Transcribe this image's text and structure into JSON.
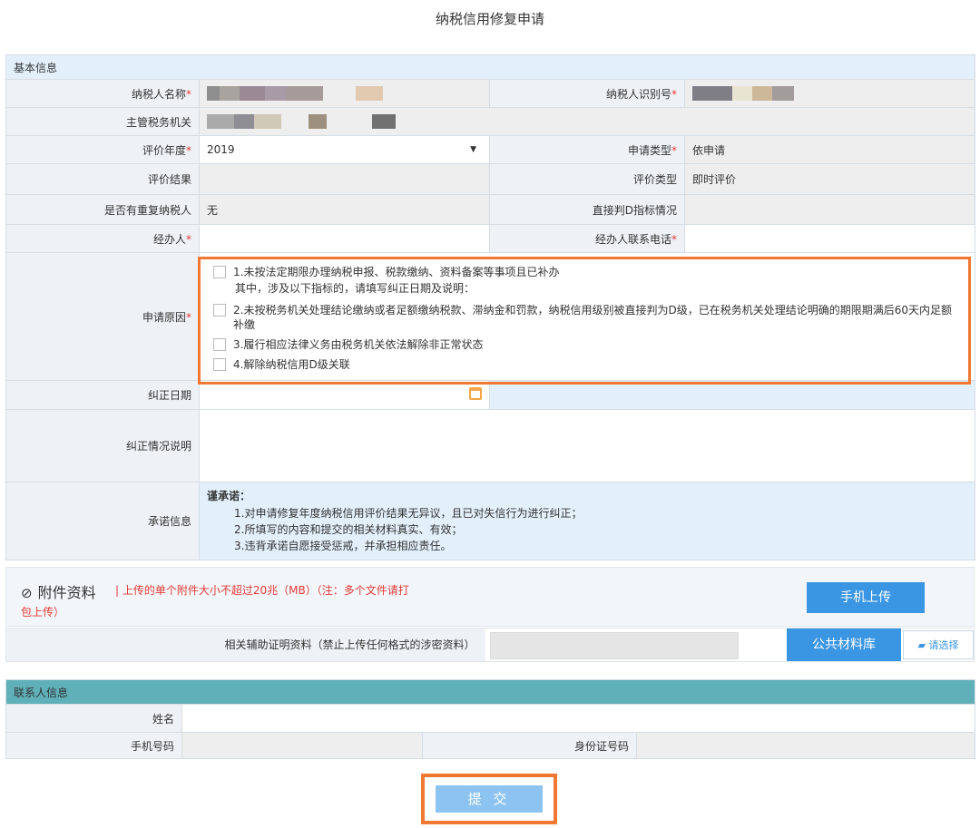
{
  "page": {
    "title": "纳税信用修复申请"
  },
  "basic": {
    "section_title": "基本信息",
    "taxpayer_name_label": "纳税人名称",
    "taxpayer_id_label": "纳税人识别号",
    "authority_label": "主管税务机关",
    "year_label": "评价年度",
    "year_value": "2019",
    "apply_type_label": "申请类型",
    "apply_type_value": "依申请",
    "result_label": "评价结果",
    "result_value": "",
    "eval_type_label": "评价类型",
    "eval_type_value": "即时评价",
    "repeat_label": "是否有重复纳税人",
    "repeat_value": "无",
    "direct_d_label": "直接判D指标情况",
    "direct_d_value": "",
    "agent_label": "经办人",
    "agent_phone_label": "经办人联系电话",
    "required_mark": "*",
    "reason_label": "申请原因",
    "reasons": [
      "1.未按法定期限办理纳税申报、税款缴纳、资料备案等事项且已补办",
      "2.未按税务机关处理结论缴纳或者足额缴纳税款、滞纳金和罚款，纳税信用级别被直接判为D级，已在税务机关处理结论明确的期限期满后60天内足额补缴",
      "3.履行相应法律义务由税务机关依法解除非正常状态",
      "4.解除纳税信用D级关联"
    ],
    "reason_subnote": "其中，涉及以下指标的，请填写纠正日期及说明：",
    "correct_date_label": "纠正日期",
    "correct_desc_label": "纠正情况说明",
    "promise_label": "承诺信息",
    "promise_title": "谨承诺：",
    "promises": [
      "1.对申请修复年度纳税信用评价结果无异议，且已对失信行为进行纠正；",
      "2.所填写的内容和提交的相关材料真实、有效；",
      "3.违背承诺自愿接受惩戒，并承担相应责任。"
    ]
  },
  "attachments": {
    "title": "附件资料",
    "note_line1": "| 上传的单个附件大小不超过20兆（MB）（注：多个文件请打",
    "note_line2": "包上传）",
    "mobile_upload": "手机上传",
    "support_label": "相关辅助证明资料（禁止上传任何格式的涉密资料）",
    "public_library": "公共材料库",
    "choose": "请选择"
  },
  "contact": {
    "section_title": "联系人信息",
    "name_label": "姓名",
    "phone_label": "手机号码",
    "id_label": "身份证号码"
  },
  "submit": {
    "label": "提 交"
  },
  "colors": {
    "accent": "#3a95e3",
    "highlight": "#f07832",
    "contact_head": "#5fb0b8",
    "required": "#e53935"
  }
}
